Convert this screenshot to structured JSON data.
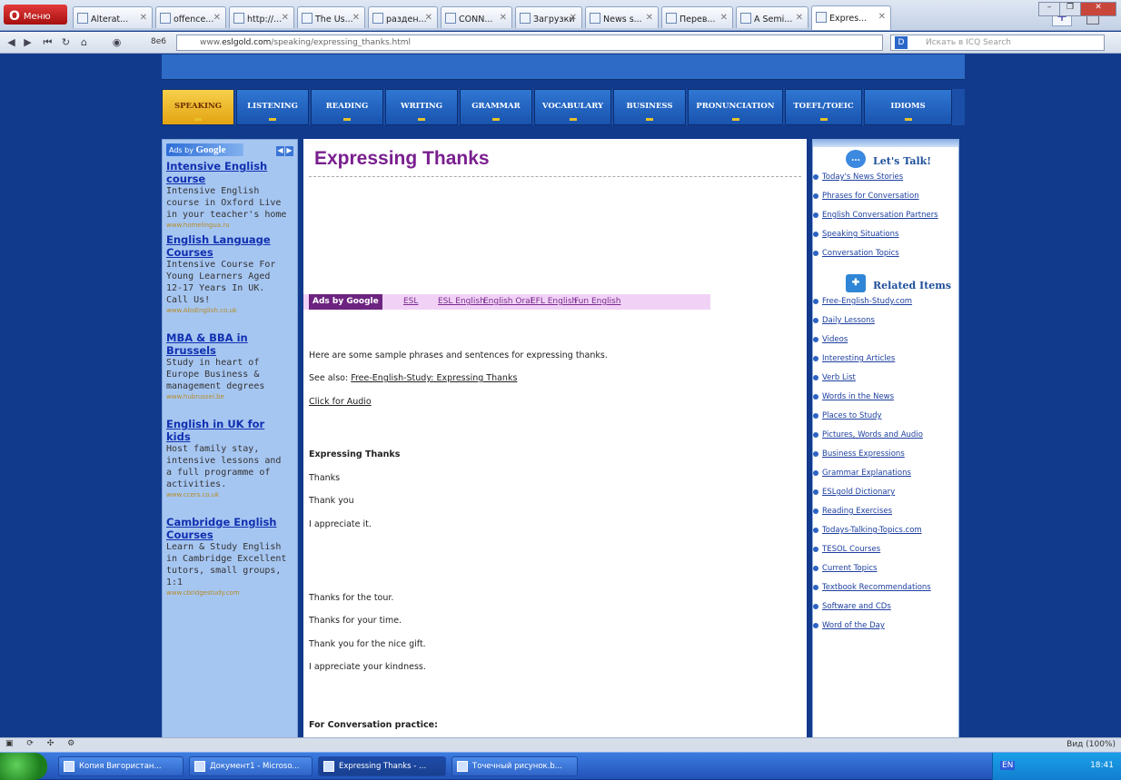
{
  "browser": {
    "menu_label": "Меню",
    "tabs": [
      {
        "label": "Alterat..."
      },
      {
        "label": "offence..."
      },
      {
        "label": "http://..."
      },
      {
        "label": "The Us..."
      },
      {
        "label": "разден..."
      },
      {
        "label": "CONN..."
      },
      {
        "label": "Загрузки"
      },
      {
        "label": "News s..."
      },
      {
        "label": "Перев..."
      },
      {
        "label": "A Semi..."
      },
      {
        "label": "Expres..."
      }
    ],
    "zoom_label": "8e6",
    "url_prefix": "www.",
    "url_domain": "eslgold.com",
    "url_path": "/speaking/expressing_thanks.html",
    "search_placeholder": "Искать в ICQ Search",
    "window_controls": [
      "–",
      "❐",
      "✕"
    ]
  },
  "site_nav": [
    "SPEAKING",
    "LISTENING",
    "READING",
    "WRITING",
    "GRAMMAR",
    "VOCABULARY",
    "BUSINESS",
    "PRONUNCIATION",
    "TOEFL/TOEIC",
    "IDIOMS"
  ],
  "left_ads": {
    "ads_label": "Ads by",
    "ads_brand": "Google",
    "items": [
      {
        "title": "Intensive English course",
        "desc": "Intensive English course in Oxford Live in your teacher's home",
        "url": "www.homelingua.ru"
      },
      {
        "title": "English Language Courses",
        "desc": "Intensive Course For Young Learners Aged 12-17 Years In UK. Call Us!",
        "url": "www.AbsEnglish.co.uk"
      },
      {
        "title": "MBA & BBA in Brussels",
        "desc": "Study in heart of Europe Business & management degrees",
        "url": "www.hubrussel.be"
      },
      {
        "title": "English in UK for kids",
        "desc": "Host family stay, intensive lessons and a full programme of activities.",
        "url": "www.ccers.co.uk"
      },
      {
        "title": "Cambridge English Courses",
        "desc": "Learn & Study English in Cambridge Excellent tutors, small groups, 1:1",
        "url": "www.cbridgestudy.com"
      }
    ]
  },
  "main": {
    "title": "Expressing Thanks",
    "ad_links_label": "Ads by Google",
    "ad_links": [
      "ESL",
      "ESL English",
      "English Oral",
      "EFL English",
      "Fun English"
    ],
    "intro": "Here are some sample phrases and sentences for expressing thanks.",
    "see_also_label": "See also:",
    "see_also_link": "Free-English-Study: Expressing Thanks",
    "audio_link": "Click for Audio",
    "section_heading": "Expressing Thanks",
    "phrases_1": [
      "Thanks",
      "Thank you",
      "I appreciate it."
    ],
    "phrases_2": [
      "Thanks for the tour.",
      "Thanks for your time.",
      "Thank you for the nice gift.",
      "I appreciate your kindness."
    ],
    "practice_heading": "For Conversation practice:"
  },
  "right": {
    "talk_heading": "Let's Talk!",
    "talk_items": [
      "Today's News Stories",
      "Phrases for Conversation",
      "English Conversation Partners",
      "Speaking Situations",
      "Conversation Topics"
    ],
    "related_heading": "Related Items",
    "related_items": [
      "Free-English-Study.com",
      "Daily Lessons",
      "Videos",
      "Interesting Articles",
      "Verb List",
      "Words in the News",
      "Places to Study",
      "Pictures, Words and Audio",
      "Business Expressions",
      "Grammar Explanations",
      "ESLgold Dictionary",
      "Reading Exercises",
      "Todays-Talking-Topics.com",
      "TESOL Courses",
      "Current Topics",
      "Textbook Recommendations",
      "Software and CDs",
      "Word of the Day"
    ]
  },
  "statusbar": {
    "zoom": "Вид (100%)"
  },
  "taskbar": {
    "tasks": [
      "Копия Вигористан...",
      "Документ1 - Microso...",
      "Expressing Thanks - ...",
      "Точечный рисунок.b..."
    ],
    "lang": "EN",
    "clock": "18:41"
  }
}
